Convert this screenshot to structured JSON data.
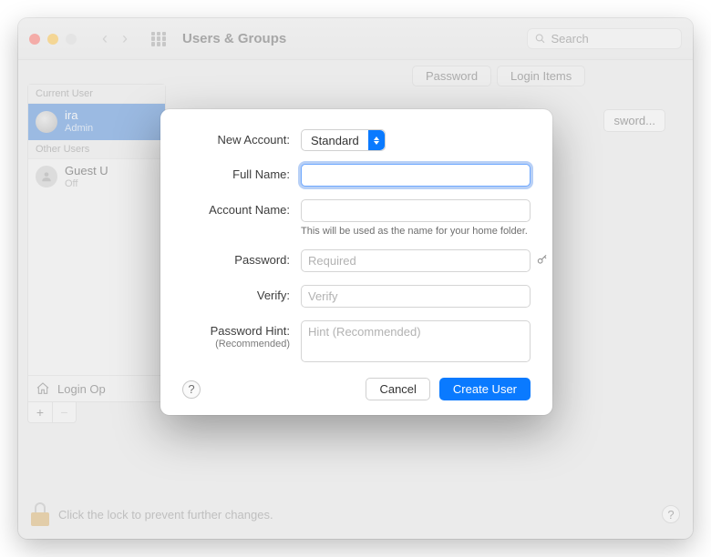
{
  "titlebar": {
    "title": "Users & Groups",
    "search_placeholder": "Search"
  },
  "sidebar": {
    "current_label": "Current User",
    "other_label": "Other Users",
    "current_user": {
      "name": "ira",
      "role": "Admin"
    },
    "other_user": {
      "name": "Guest U",
      "role": "Off"
    },
    "login_options": "Login Op"
  },
  "tabs": {
    "password": "Password",
    "login_items": "Login Items"
  },
  "main": {
    "change_password": "sword...",
    "lock_text": "Click the lock to prevent further changes."
  },
  "modal": {
    "new_account_label": "New Account:",
    "new_account_value": "Standard",
    "full_name_label": "Full Name:",
    "account_name_label": "Account Name:",
    "account_name_hint": "This will be used as the name for your home folder.",
    "password_label": "Password:",
    "password_placeholder": "Required",
    "verify_label": "Verify:",
    "verify_placeholder": "Verify",
    "hint_label": "Password Hint:",
    "hint_sub": "(Recommended)",
    "hint_placeholder": "Hint (Recommended)",
    "cancel": "Cancel",
    "create_user": "Create User"
  }
}
